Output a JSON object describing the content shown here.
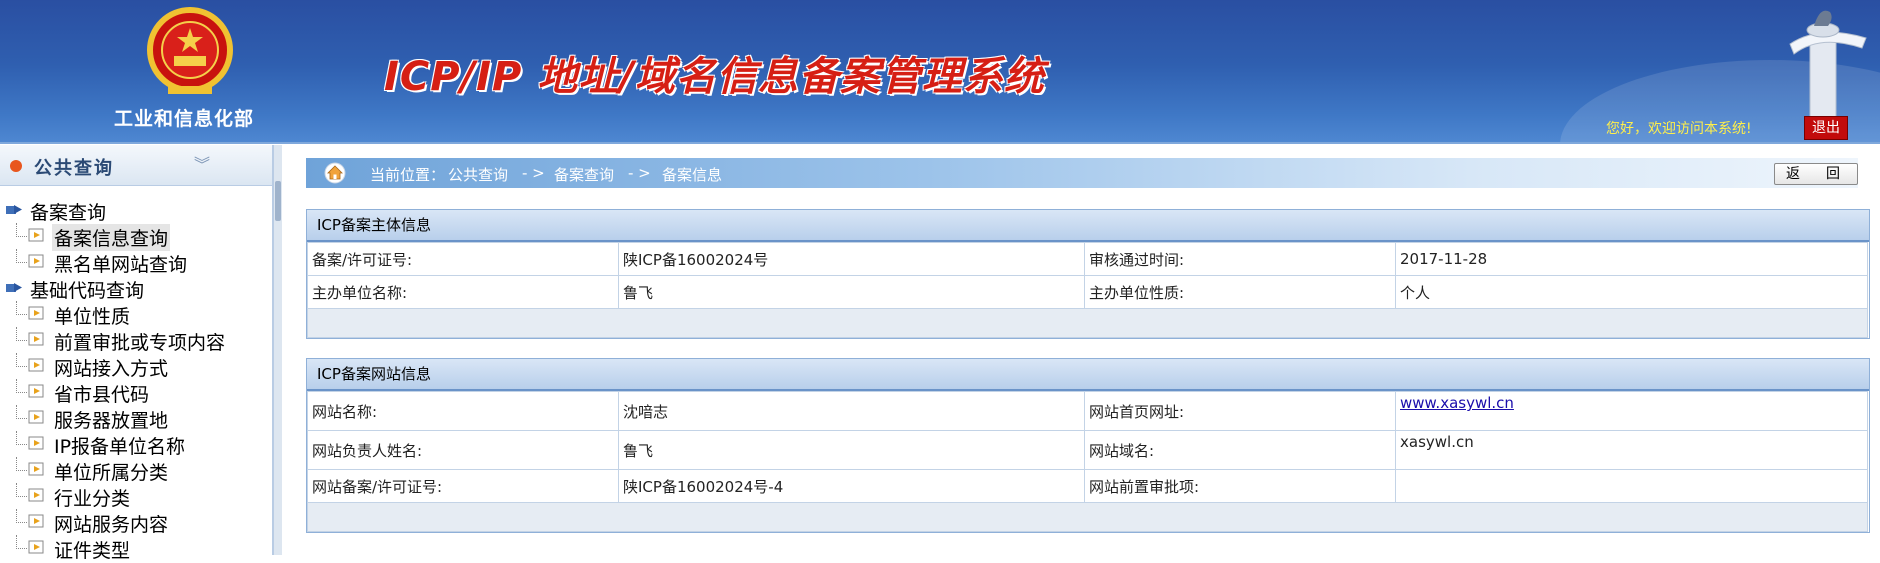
{
  "header": {
    "ministry": "工业和信息化部",
    "title": "ICP/IP 地址/域名信息备案管理系统",
    "welcome": "您好，欢迎访问本系统!",
    "logout": "退出"
  },
  "sidebar": {
    "title": "公共查询",
    "groups": [
      {
        "label": "备案查询",
        "items": [
          "备案信息查询",
          "黑名单网站查询"
        ]
      },
      {
        "label": "基础代码查询",
        "items": [
          "单位性质",
          "前置审批或专项内容",
          "网站接入方式",
          "省市县代码",
          "服务器放置地",
          "IP报备单位名称",
          "单位所属分类",
          "行业分类",
          "网站服务内容",
          "证件类型"
        ]
      }
    ]
  },
  "breadcrumb": {
    "prefix": "当前位置：",
    "items": [
      "公共查询",
      "- >",
      "备案查询",
      "- >",
      "备案信息"
    ]
  },
  "back_button": "返　回",
  "subject_panel": {
    "title": "ICP备案主体信息",
    "rows": [
      {
        "k1": "备案/许可证号:",
        "v1": "陕ICP备16002024号",
        "k2": "审核通过时间:",
        "v2": "2017-11-28"
      },
      {
        "k1": "主办单位名称:",
        "v1": "鲁飞",
        "k2": "主办单位性质:",
        "v2": "个人"
      }
    ]
  },
  "site_panel": {
    "title": "ICP备案网站信息",
    "rows": [
      {
        "k1": "网站名称:",
        "v1": "沈喑志",
        "k2": "网站首页网址:",
        "v2": "www.xasywl.cn"
      },
      {
        "k1": "网站负责人姓名:",
        "v1": "鲁飞",
        "k2": "网站域名:",
        "v2": "xasywl.cn"
      },
      {
        "k1": "网站备案/许可证号:",
        "v1": "陕ICP备16002024号-4",
        "k2": "网站前置审批项:",
        "v2": ""
      }
    ]
  },
  "colors": {
    "header_blue": "#2f5fb0",
    "title_red": "#d61f14",
    "welcome_yellow": "#ffef4a",
    "logout_red": "#c20b0b"
  }
}
